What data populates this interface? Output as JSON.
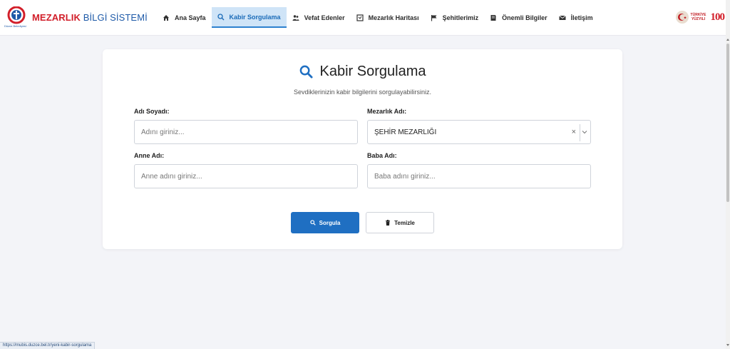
{
  "brand": {
    "title_bold": "MEZARLIK",
    "title_light": "BİLGİ SİSTEMİ",
    "logo_caption": "Düzce Belediyesi"
  },
  "nav": {
    "items": [
      {
        "label": "Ana Sayfa",
        "icon": "home-icon",
        "active": false
      },
      {
        "label": "Kabir Sorgulama",
        "icon": "search-icon",
        "active": true
      },
      {
        "label": "Vefat Edenler",
        "icon": "users-icon",
        "active": false
      },
      {
        "label": "Mezarlık Haritası",
        "icon": "map-icon",
        "active": false
      },
      {
        "label": "Şehitlerimiz",
        "icon": "flag-icon",
        "active": false
      },
      {
        "label": "Önemli Bilgiler",
        "icon": "book-icon",
        "active": false
      },
      {
        "label": "İletişim",
        "icon": "envelope-icon",
        "active": false
      }
    ]
  },
  "right_logos": {
    "turkiye_line1": "TÜRKİYE",
    "turkiye_line2": "YÜZYILI",
    "hundred": "100"
  },
  "page": {
    "title": "Kabir Sorgulama",
    "subtitle": "Sevdiklerinizin kabir bilgilerini sorgulayabilirsiniz."
  },
  "form": {
    "name": {
      "label": "Adı Soyadı:",
      "placeholder": "Adını giriniz...",
      "value": ""
    },
    "cemetery": {
      "label": "Mezarlık Adı:",
      "value": "ŞEHİR MEZARLIĞI",
      "clear": "×"
    },
    "mother": {
      "label": "Anne Adı:",
      "placeholder": "Anne adını giriniz...",
      "value": ""
    },
    "father": {
      "label": "Baba Adı:",
      "placeholder": "Baba adını giriniz...",
      "value": ""
    },
    "submit_label": "Sorgula",
    "reset_label": "Temizle"
  },
  "status_url": "https://mubis.duzce.bel.tr/yeni-kabir-sorgulama",
  "colors": {
    "brand_red": "#d21f2a",
    "brand_blue": "#1e5aa8",
    "primary": "#1f6fc2",
    "active_nav_bg": "#cfe4f7"
  }
}
